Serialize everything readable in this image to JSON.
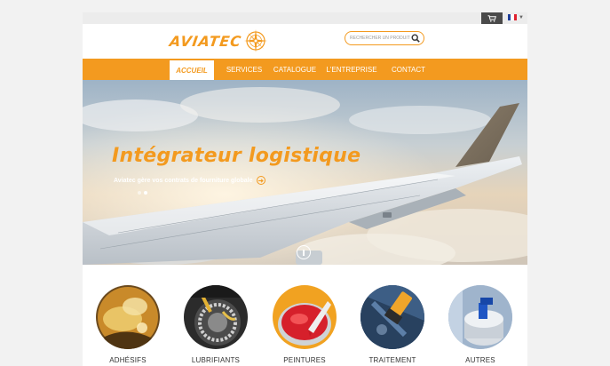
{
  "topbar": {
    "cart_icon": "cart-icon",
    "language": "FR",
    "flag_colors": [
      "#1f3f9a",
      "#ffffff",
      "#e0212f"
    ]
  },
  "header": {
    "logo_text": "AVIATEC",
    "search_placeholder": "RECHERCHER UN PRODUIT"
  },
  "nav": {
    "items": [
      {
        "label": "ACCUEIL",
        "active": true
      },
      {
        "label": "SERVICES",
        "active": false
      },
      {
        "label": "CATALOGUE",
        "active": false
      },
      {
        "label": "L'ENTREPRISE",
        "active": false
      },
      {
        "label": "CONTACT",
        "active": false
      }
    ]
  },
  "hero": {
    "title": "Intégrateur logistique",
    "subtitle": "Aviatec gère vos contrats de fourniture globale",
    "slide_count": 2,
    "active_slide": 1
  },
  "categories": [
    {
      "label": "ADHÉSIFS",
      "icon": "adhesive-image"
    },
    {
      "label": "LUBRIFIANTS",
      "icon": "lubricant-image"
    },
    {
      "label": "PEINTURES",
      "icon": "paint-image"
    },
    {
      "label": "TRAITEMENT",
      "icon": "treatment-image"
    },
    {
      "label": "AUTRES",
      "icon": "spray-can-image"
    }
  ],
  "colors": {
    "accent": "#f39a1f",
    "nav_text": "#ffffff",
    "topbar": "#ececec",
    "cart_button": "#4a4a4a"
  }
}
